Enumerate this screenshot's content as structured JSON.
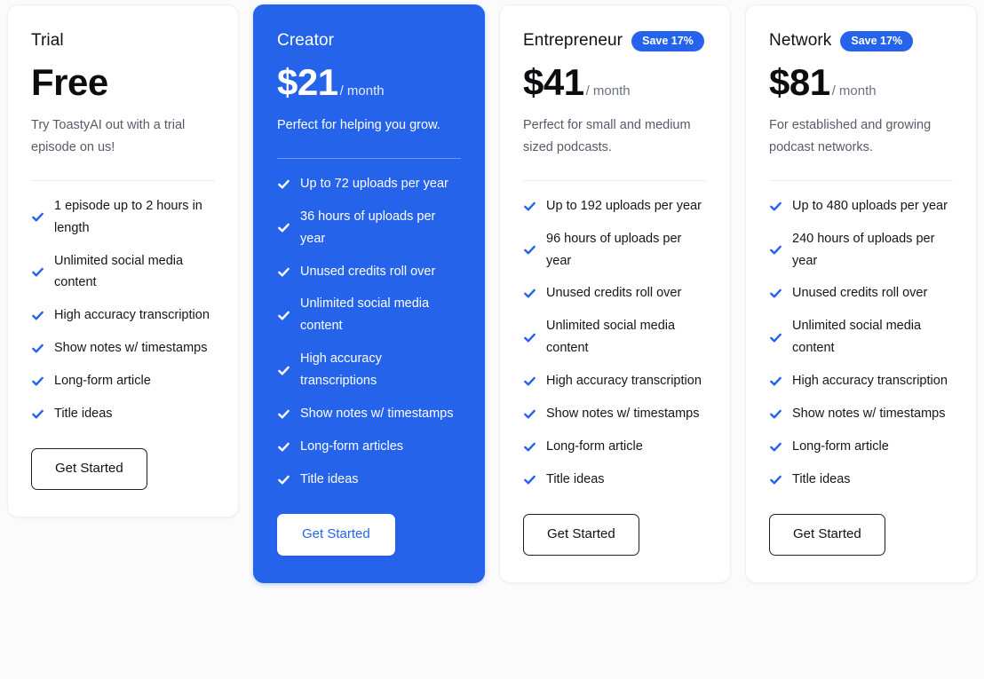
{
  "theme": {
    "accent": "#2563eb",
    "page_background": "#fbfbfc",
    "card_background": "#ffffff",
    "featured_text": "#ffffff"
  },
  "icons": {
    "check": "check-icon"
  },
  "plans": [
    {
      "name": "Trial",
      "badge": null,
      "price": "Free",
      "period": null,
      "description": "Try ToastyAI out with a trial episode on us!",
      "features": [
        "1 episode up to 2 hours in length",
        "Unlimited social media content",
        "High accuracy transcription",
        "Show notes w/ timestamps",
        "Long-form article",
        "Title ideas"
      ],
      "cta": "Get Started",
      "featured": false
    },
    {
      "name": "Creator",
      "badge": null,
      "price": "$21",
      "period": "/ month",
      "description": "Perfect for helping you grow.",
      "features": [
        "Up to 72 uploads per year",
        "36 hours of uploads per year",
        "Unused credits roll over",
        "Unlimited social media content",
        "High accuracy transcriptions",
        "Show notes w/ timestamps",
        "Long-form articles",
        "Title ideas"
      ],
      "cta": "Get Started",
      "featured": true
    },
    {
      "name": "Entrepreneur",
      "badge": "Save 17%",
      "price": "$41",
      "period": "/ month",
      "description": "Perfect for small and medium sized podcasts.",
      "features": [
        "Up to 192 uploads per year",
        "96 hours of uploads per year",
        "Unused credits roll over",
        "Unlimited social media content",
        "High accuracy transcription",
        "Show notes w/ timestamps",
        "Long-form article",
        "Title ideas"
      ],
      "cta": "Get Started",
      "featured": false
    },
    {
      "name": "Network",
      "badge": "Save 17%",
      "price": "$81",
      "period": "/ month",
      "description": "For established and growing podcast networks.",
      "features": [
        "Up to 480 uploads per year",
        "240 hours of uploads per year",
        "Unused credits roll over",
        "Unlimited social media content",
        "High accuracy transcription",
        "Show notes w/ timestamps",
        "Long-form article",
        "Title ideas"
      ],
      "cta": "Get Started",
      "featured": false
    }
  ]
}
